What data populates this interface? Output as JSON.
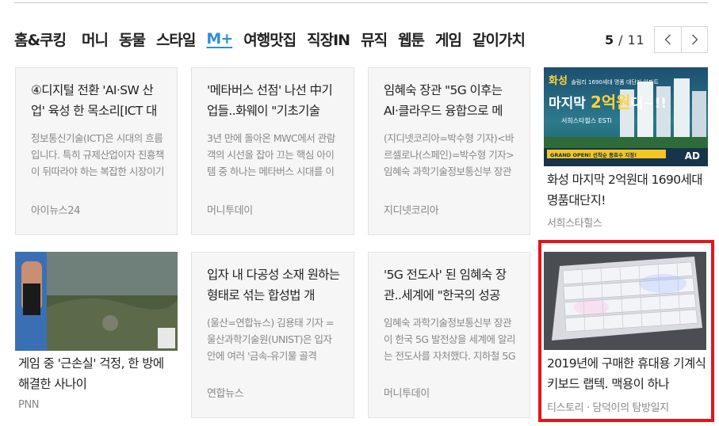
{
  "tabs": [
    {
      "label": "홈&쿠킹",
      "active": false
    },
    {
      "label": "머니",
      "active": false
    },
    {
      "label": "동물",
      "active": false
    },
    {
      "label": "스타일",
      "active": false
    },
    {
      "label": "M+",
      "active": true
    },
    {
      "label": "여행맛집",
      "active": false
    },
    {
      "label": "직장IN",
      "active": false
    },
    {
      "label": "뮤직",
      "active": false
    },
    {
      "label": "웹툰",
      "active": false
    },
    {
      "label": "게임",
      "active": false
    },
    {
      "label": "같이가치",
      "active": false
    }
  ],
  "pager": {
    "current": "5",
    "separator": " / ",
    "total": "11",
    "prev_icon": "chevron-left-icon",
    "next_icon": "chevron-right-icon"
  },
  "cards": [
    {
      "title": "④디지털 전환 'AI·SW 산업' 육성 한 목소리[ICT 대",
      "desc": "정보통신기술(ICT)은 시대의 흐름입니다. 특히 규제산업이자 진흥책이 뒤따라야 하는 복잡한 시장이기",
      "source": "아이뉴스24"
    },
    {
      "title": "'메타버스 선점' 나선 中기업들..화웨이 \"기초기술",
      "desc": "3년 만에 돌아온 MWC에서 관람객의 시선을 잡아 끄는 핵심 아이템 중 하나는 메타버스 시대를 이끌",
      "source": "머니투데이"
    },
    {
      "title": "임혜숙 장관 \"5G 이후는 AI·클라우드 융합으로 메",
      "desc": "(지디넷코리아=박수형 기자)<바르셀로나(스페인)=박수형 기자> 임혜숙 과학기술정보통신부 장관이",
      "source": "지디넷코리아"
    },
    {
      "title": "입자 내 다공성 소재 원하는 형태로 섞는 합성법 개",
      "desc": "(울산=연합뉴스) 김용태 기자 = 울산과학기술원(UNIST)은 입자 안에 여러 '금속-유기물 골격",
      "source": "연합뉴스"
    },
    {
      "title": "'5G 전도사' 된 임혜숙 장관..세계에 \"한국의 성공",
      "desc": "임혜숙 과학기술정보통신부 장관이 한국 5G 발전상을 세계에 알리는 전도사를 자처했다. 지하철 5G",
      "source": "머니투데이"
    }
  ],
  "ad_card": {
    "title": "화성 마지막 2억원대 1690세대 명품대단지!",
    "source": "서희스타힐스",
    "badge": "AD",
    "banner": {
      "brand": "화성",
      "sub": "솔림리 1690세대 명품 대단지 아파트",
      "headline_a": "마지막 ",
      "headline_b": "2억원",
      "headline_c": "대~!!",
      "logo": "서희스타힐스 ESTi",
      "strip": "GRAND OPEN! 선착순 동호수 지정!"
    }
  },
  "game_card": {
    "title": "게임 중 '근손실' 걱정, 한 방에 해결한 사나이",
    "source": "PNN"
  },
  "keyboard_card": {
    "title": "2019년에 구매한 휴대용 기계식 키보드 랩텍. 맥용이 하나",
    "source": "티스토리 · 담덕이의 탐방일지"
  },
  "colors": {
    "accent": "#2f8fd8",
    "highlight": "#e8141b"
  }
}
